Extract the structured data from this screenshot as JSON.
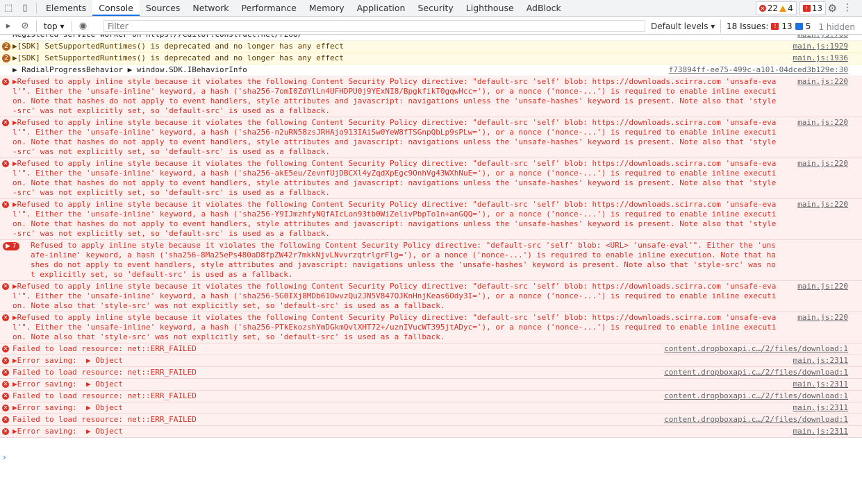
{
  "tabs": [
    "Elements",
    "Console",
    "Sources",
    "Network",
    "Performance",
    "Memory",
    "Application",
    "Security",
    "Lighthouse",
    "AdBlock"
  ],
  "active_tab": "Console",
  "counts": {
    "errors": "22",
    "warnings": "4",
    "issues": "13"
  },
  "toolbar": {
    "context": "top",
    "filter_placeholder": "Filter",
    "levels": "Default levels",
    "issues_label": "18 Issues:",
    "issues_red": "13",
    "issues_blue": "5",
    "hidden": "1 hidden"
  },
  "messages": [
    {
      "type": "info",
      "text": "Registered service worker on https://editor.construct.net/r268/",
      "src": "main.js:706"
    },
    {
      "type": "warn",
      "count": "2",
      "text": "▶[SDK] SetSupportedRuntimes() is deprecated and no longer has any effect",
      "src": "main.js:1929"
    },
    {
      "type": "warn",
      "count": "2",
      "text": "▶[SDK] SetSupportedRuntimes() is deprecated and no longer has any effect",
      "src": "main.js:1936"
    },
    {
      "type": "info",
      "text": "▶ RadialProgressBehavior ▶ window.SDK.IBehaviorInfo",
      "src": "f73894ff-ee75-499c-a101-04dced3b129e:30"
    },
    {
      "type": "err",
      "text": "▶Refused to apply inline style because it violates the following Content Security Policy directive: \"default-src 'self' blob: https://downloads.scirra.com 'unsafe-eval'\". Either the 'unsafe-inline' keyword, a hash ('sha256-7omI0ZdYlLn4UFHDPU0j9YExNI8/BpgkfikT0gqwHcc='), or a nonce ('nonce-...') is required to enable inline execution. Note that hashes do not apply to event handlers, style attributes and javascript: navigations unless the 'unsafe-hashes' keyword is present. Note also that 'style-src' was not explicitly set, so 'default-src' is used as a fallback.",
      "src": "main.js:220"
    },
    {
      "type": "err",
      "text": "▶Refused to apply inline style because it violates the following Content Security Policy directive: \"default-src 'self' blob: https://downloads.scirra.com 'unsafe-eval'\". Either the 'unsafe-inline' keyword, a hash ('sha256-n2uRN58zsJRHAjo913IAiSw0YeW8fTSGnpQbLp9sPLw='), or a nonce ('nonce-...') is required to enable inline execution. Note that hashes do not apply to event handlers, style attributes and javascript: navigations unless the 'unsafe-hashes' keyword is present. Note also that 'style-src' was not explicitly set, so 'default-src' is used as a fallback.",
      "src": "main.js:220"
    },
    {
      "type": "err",
      "text": "▶Refused to apply inline style because it violates the following Content Security Policy directive: \"default-src 'self' blob: https://downloads.scirra.com 'unsafe-eval'\". Either the 'unsafe-inline' keyword, a hash ('sha256-akE5eu/ZevnfUjDBCXl4yZqdXpEgc9OnhVg43WXhNuE='), or a nonce ('nonce-...') is required to enable inline execution. Note that hashes do not apply to event handlers, style attributes and javascript: navigations unless the 'unsafe-hashes' keyword is present. Note also that 'style-src' was not explicitly set, so 'default-src' is used as a fallback.",
      "src": "main.js:220"
    },
    {
      "type": "err",
      "text": "▶Refused to apply inline style because it violates the following Content Security Policy directive: \"default-src 'self' blob: https://downloads.scirra.com 'unsafe-eval'\". Either the 'unsafe-inline' keyword, a hash ('sha256-Y9IJmzhfyNQfAIcLon93tb0WiZelivPbpTo1n+anGQQ='), or a nonce ('nonce-...') is required to enable inline execution. Note that hashes do not apply to event handlers, style attributes and javascript: navigations unless the 'unsafe-hashes' keyword is present. Note also that 'style-src' was not explicitly set, so 'default-src' is used as a fallback.",
      "src": "main.js:220"
    },
    {
      "type": "err7",
      "count": "7",
      "text": "Refused to apply inline style because it violates the following Content Security Policy directive: \"default-src 'self' blob: <URL> 'unsafe-eval'\". Either the 'unsafe-inline' keyword, a hash ('sha256-8Ma25ePs480aD8fpZW42r7mkkNjvLNvvrzqtrlgrFlg='), or a nonce ('nonce-...') is required to enable inline execution. Note that hashes do not apply to event handlers, style attributes and javascript: navigations unless the 'unsafe-hashes' keyword is present. Note also that 'style-src' was not explicitly set, so 'default-src' is used as a fallback.",
      "src": ""
    },
    {
      "type": "err",
      "text": "▶Refused to apply inline style because it violates the following Content Security Policy directive: \"default-src 'self' blob: https://downloads.scirra.com 'unsafe-eval'\". Either the 'unsafe-inline' keyword, a hash ('sha256-5G0IXj8MDb61OwvzQu2JN5V847OJKnHnjKeas6Ody3I='), or a nonce ('nonce-...') is required to enable inline execution. Note also that 'style-src' was not explicitly set, so 'default-src' is used as a fallback.",
      "src": "main.js:220"
    },
    {
      "type": "err",
      "text": "▶Refused to apply inline style because it violates the following Content Security Policy directive: \"default-src 'self' blob: https://downloads.scirra.com 'unsafe-eval'\". Either the 'unsafe-inline' keyword, a hash ('sha256-PTkEkozshYmDGkmQvlXHT72+/uznIVucWT395jtADyc='), or a nonce ('nonce-...') is required to enable inline execution. Note also that 'style-src' was not explicitly set, so 'default-src' is used as a fallback.",
      "src": "main.js:220"
    },
    {
      "type": "err",
      "text": "Failed to load resource: net::ERR_FAILED",
      "src": "content.dropboxapi.c…/2/files/download:1"
    },
    {
      "type": "err",
      "text": "▶Error saving:  ▶ Object",
      "src": "main.js:2311"
    },
    {
      "type": "err",
      "text": "Failed to load resource: net::ERR_FAILED",
      "src": "content.dropboxapi.c…/2/files/download:1"
    },
    {
      "type": "err",
      "text": "▶Error saving:  ▶ Object",
      "src": "main.js:2311"
    },
    {
      "type": "err",
      "text": "Failed to load resource: net::ERR_FAILED",
      "src": "content.dropboxapi.c…/2/files/download:1"
    },
    {
      "type": "err",
      "text": "▶Error saving:  ▶ Object",
      "src": "main.js:2311"
    },
    {
      "type": "err",
      "text": "Failed to load resource: net::ERR_FAILED",
      "src": "content.dropboxapi.c…/2/files/download:1"
    },
    {
      "type": "err",
      "text": "▶Error saving:  ▶ Object",
      "src": "main.js:2311"
    }
  ],
  "prompt": "›"
}
